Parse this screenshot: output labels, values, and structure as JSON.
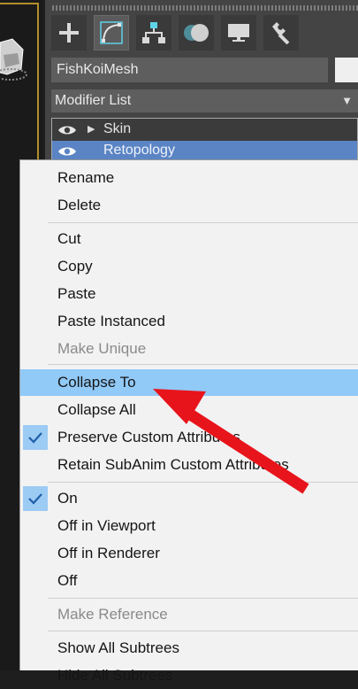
{
  "object_name": "FishKoiMesh",
  "modifier_list_label": "Modifier List",
  "modifier_list_arrow": "▼",
  "tabs": [
    {
      "name": "create",
      "icon": "plus-icon"
    },
    {
      "name": "modify",
      "icon": "modify-curve-icon"
    },
    {
      "name": "hierarchy",
      "icon": "hierarchy-icon"
    },
    {
      "name": "motion",
      "icon": "motion-icon"
    },
    {
      "name": "display",
      "icon": "display-monitor-icon"
    },
    {
      "name": "utilities",
      "icon": "wrench-icon"
    }
  ],
  "stack": [
    {
      "label": "Skin",
      "expand_arrow": "▶"
    },
    {
      "label": "Retopology"
    }
  ],
  "menu": {
    "items": [
      {
        "label": "Rename"
      },
      {
        "label": "Delete"
      },
      {
        "label": "Cut"
      },
      {
        "label": "Copy"
      },
      {
        "label": "Paste"
      },
      {
        "label": "Paste Instanced"
      },
      {
        "label": "Make Unique"
      },
      {
        "label": "Collapse To"
      },
      {
        "label": "Collapse All"
      },
      {
        "label": "Preserve Custom Attributes"
      },
      {
        "label": "Retain SubAnim Custom Attributes"
      },
      {
        "label": "On"
      },
      {
        "label": "Off in Viewport"
      },
      {
        "label": "Off in Renderer"
      },
      {
        "label": "Off"
      },
      {
        "label": "Make Reference"
      },
      {
        "label": "Show All Subtrees"
      },
      {
        "label": "Hide All Subtrees"
      }
    ],
    "disabled": [
      "Make Unique",
      "Make Reference"
    ],
    "highlighted": "Collapse To",
    "checked": [
      "Preserve Custom Attributes",
      "On"
    ]
  },
  "colors": {
    "panel_bg": "#444444",
    "selection_blue": "#5b84c4",
    "menu_hover": "#91c9f7",
    "annotation_red": "#e8141b",
    "viewport_frame": "#b38f2a"
  }
}
